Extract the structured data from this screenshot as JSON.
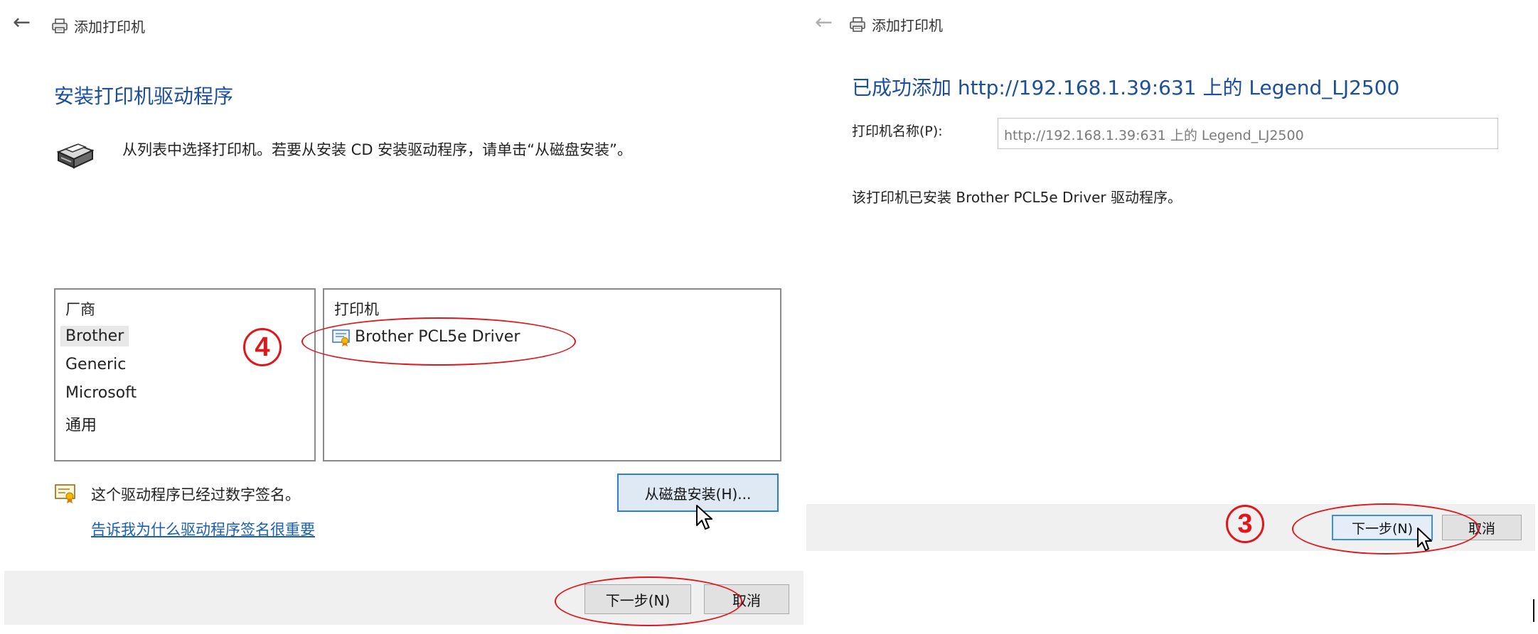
{
  "left_panel": {
    "title": "添加打印机",
    "heading": "安装打印机驱动程序",
    "instruction": "从列表中选择打印机。若要从安装 CD 安装驱动程序，请单击“从磁盘安装”。",
    "manufacturer_list": {
      "header": "厂商",
      "items": [
        "Brother",
        "Generic",
        "Microsoft",
        "通用"
      ],
      "selected": "Brother"
    },
    "printer_list": {
      "header": "打印机",
      "items": [
        "Brother PCL5e Driver"
      ]
    },
    "signature_text": "这个驱动程序已经过数字签名。",
    "signature_link": "告诉我为什么驱动程序签名很重要",
    "have_disk_button": "从磁盘安装(H)...",
    "next_button": "下一步(N)",
    "cancel_button": "取消",
    "annotation": "4"
  },
  "right_panel": {
    "title": "添加打印机",
    "heading": "已成功添加 http://192.168.1.39:631 上的 Legend_LJ2500",
    "printer_name_label": "打印机名称(P):",
    "printer_name_value": "http://192.168.1.39:631 上的 Legend_LJ2500",
    "driver_info": "该打印机已安装 Brother PCL5e Driver 驱动程序。",
    "next_button": "下一步(N)",
    "cancel_button": "取消",
    "annotation": "3"
  },
  "colors": {
    "heading_blue": "#1b4f9c",
    "annotation_red": "#e0161a",
    "link_blue": "#1a5fb4",
    "footer_gray": "#f0f0f0"
  },
  "icons": [
    "back-arrow-icon",
    "printer-icon",
    "printer-driver-icon",
    "certificate-icon",
    "mouse-cursor-icon"
  ]
}
